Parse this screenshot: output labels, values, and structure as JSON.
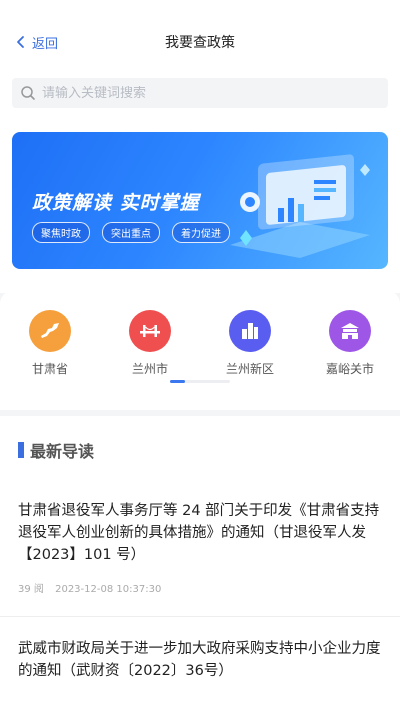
{
  "header": {
    "back_label": "返回",
    "title": "我要查政策"
  },
  "search": {
    "placeholder": "请输入关键词搜索"
  },
  "banner": {
    "title": "政策解读  实时掌握",
    "tags": [
      "聚焦时政",
      "突出重点",
      "着力促进"
    ]
  },
  "categories": [
    {
      "label": "甘肃省",
      "icon": "gansu-map-icon",
      "color": "#f5a03c"
    },
    {
      "label": "兰州市",
      "icon": "bridge-icon",
      "color": "#ef4f4f"
    },
    {
      "label": "兰州新区",
      "icon": "buildings-icon",
      "color": "#5a5ef0"
    },
    {
      "label": "嘉峪关市",
      "icon": "gate-tower-icon",
      "color": "#9e56e6"
    }
  ],
  "pager": {
    "progress": 0.25
  },
  "news": {
    "section_title": "最新导读",
    "articles": [
      {
        "title": "甘肃省退役军人事务厅等 24 部门关于印发《甘肃省支持退役军人创业创新的具体措施》的通知（甘退役军人发【2023】101 号）",
        "views": "39 阅",
        "time": "2023-12-08 10:37:30"
      },
      {
        "title": "武威市财政局关于进一步加大政府采购支持中小企业力度的通知（武财资〔2022〕36号）"
      }
    ]
  },
  "colors": {
    "accent": "#3b6fe0"
  }
}
